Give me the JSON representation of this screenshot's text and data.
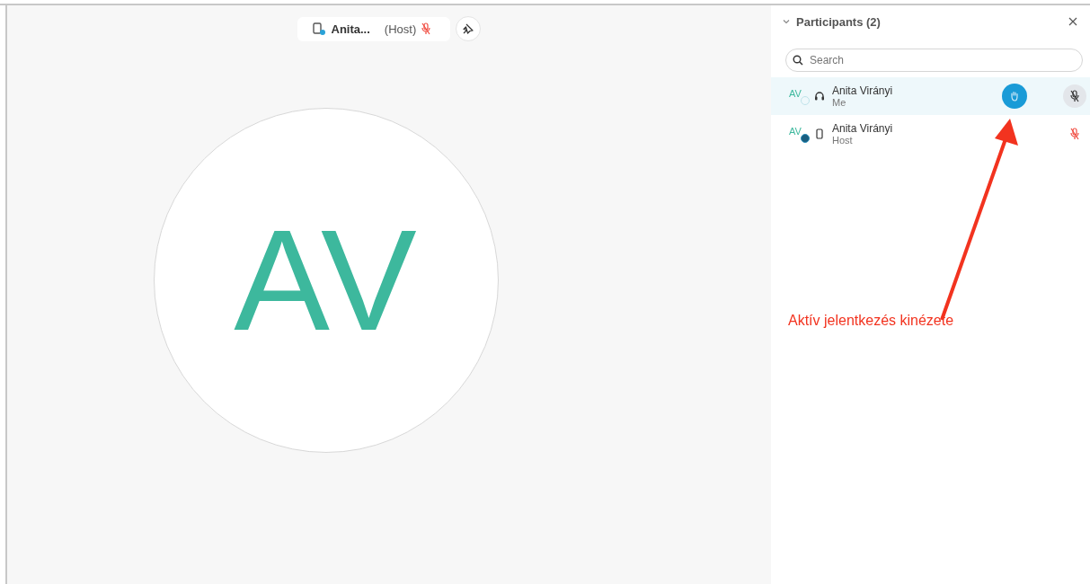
{
  "stage": {
    "chip": {
      "name": "Anita...",
      "role": "(Host)",
      "mic_muted": true
    },
    "avatar_initials": "AV"
  },
  "panel": {
    "title": "Participants (2)",
    "expanded": true,
    "search": {
      "placeholder": "Search"
    },
    "participants": [
      {
        "initials": "AV",
        "device": {
          "kind": "headset"
        },
        "name": "Anita Virányi",
        "role": "Me",
        "selected": true,
        "hand_raised": true,
        "mic": {
          "kind": "button"
        }
      },
      {
        "initials": "AV",
        "device": {
          "kind": "phone"
        },
        "name": "Anita Virányi",
        "role": "Host",
        "selected": false,
        "hand_raised": false,
        "mic": {
          "kind": "indicator"
        }
      }
    ]
  },
  "annotation": {
    "text": "Aktív jelentkezés kinézete"
  }
}
